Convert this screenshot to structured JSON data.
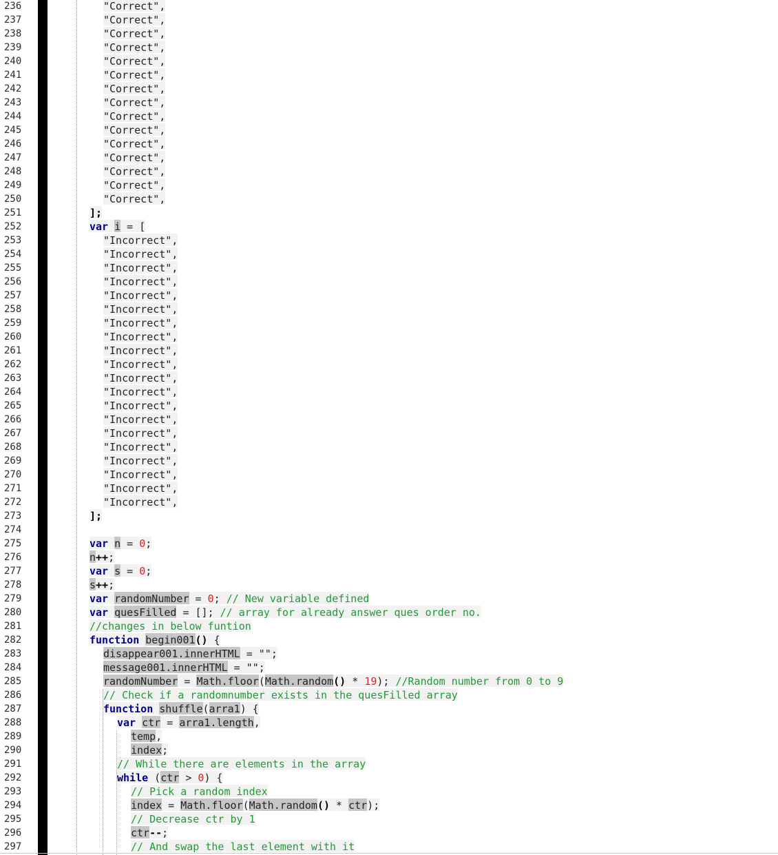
{
  "editor": {
    "lines": [
      {
        "n": "236",
        "i": 150,
        "t": [
          [
            "plain",
            "\"Correct\","
          ]
        ]
      },
      {
        "n": "237",
        "i": 150,
        "t": [
          [
            "plain",
            "\"Correct\","
          ]
        ]
      },
      {
        "n": "238",
        "i": 150,
        "t": [
          [
            "plain",
            "\"Correct\","
          ]
        ]
      },
      {
        "n": "239",
        "i": 150,
        "t": [
          [
            "plain",
            "\"Correct\","
          ]
        ]
      },
      {
        "n": "240",
        "i": 150,
        "t": [
          [
            "plain",
            "\"Correct\","
          ]
        ]
      },
      {
        "n": "241",
        "i": 150,
        "t": [
          [
            "plain",
            "\"Correct\","
          ]
        ]
      },
      {
        "n": "242",
        "i": 150,
        "t": [
          [
            "plain",
            "\"Correct\","
          ]
        ]
      },
      {
        "n": "243",
        "i": 150,
        "t": [
          [
            "plain",
            "\"Correct\","
          ]
        ]
      },
      {
        "n": "244",
        "i": 150,
        "t": [
          [
            "plain",
            "\"Correct\","
          ]
        ]
      },
      {
        "n": "245",
        "i": 150,
        "t": [
          [
            "plain",
            "\"Correct\","
          ]
        ]
      },
      {
        "n": "246",
        "i": 150,
        "t": [
          [
            "plain",
            "\"Correct\","
          ]
        ]
      },
      {
        "n": "247",
        "i": 150,
        "t": [
          [
            "plain",
            "\"Correct\","
          ]
        ]
      },
      {
        "n": "248",
        "i": 150,
        "t": [
          [
            "plain",
            "\"Correct\","
          ]
        ]
      },
      {
        "n": "249",
        "i": 150,
        "t": [
          [
            "plain",
            "\"Correct\","
          ]
        ]
      },
      {
        "n": "250",
        "i": 150,
        "t": [
          [
            "plain",
            "\"Correct\","
          ]
        ]
      },
      {
        "n": "251",
        "i": 130,
        "t": [
          [
            "op",
            "];"
          ]
        ]
      },
      {
        "n": "252",
        "i": 130,
        "t": [
          [
            "kw",
            "var"
          ],
          [
            "plain",
            " "
          ],
          [
            "hl",
            "i"
          ],
          [
            "plain",
            " = ["
          ]
        ]
      },
      {
        "n": "253",
        "i": 150,
        "t": [
          [
            "plain",
            "\"Incorrect\","
          ]
        ]
      },
      {
        "n": "254",
        "i": 150,
        "t": [
          [
            "plain",
            "\"Incorrect\","
          ]
        ]
      },
      {
        "n": "255",
        "i": 150,
        "t": [
          [
            "plain",
            "\"Incorrect\","
          ]
        ]
      },
      {
        "n": "256",
        "i": 150,
        "t": [
          [
            "plain",
            "\"Incorrect\","
          ]
        ]
      },
      {
        "n": "257",
        "i": 150,
        "t": [
          [
            "plain",
            "\"Incorrect\","
          ]
        ]
      },
      {
        "n": "258",
        "i": 150,
        "t": [
          [
            "plain",
            "\"Incorrect\","
          ]
        ]
      },
      {
        "n": "259",
        "i": 150,
        "t": [
          [
            "plain",
            "\"Incorrect\","
          ]
        ]
      },
      {
        "n": "260",
        "i": 150,
        "t": [
          [
            "plain",
            "\"Incorrect\","
          ]
        ]
      },
      {
        "n": "261",
        "i": 150,
        "t": [
          [
            "plain",
            "\"Incorrect\","
          ]
        ]
      },
      {
        "n": "262",
        "i": 150,
        "t": [
          [
            "plain",
            "\"Incorrect\","
          ]
        ]
      },
      {
        "n": "263",
        "i": 150,
        "t": [
          [
            "plain",
            "\"Incorrect\","
          ]
        ]
      },
      {
        "n": "264",
        "i": 150,
        "t": [
          [
            "plain",
            "\"Incorrect\","
          ]
        ]
      },
      {
        "n": "265",
        "i": 150,
        "t": [
          [
            "plain",
            "\"Incorrect\","
          ]
        ]
      },
      {
        "n": "266",
        "i": 150,
        "t": [
          [
            "plain",
            "\"Incorrect\","
          ]
        ]
      },
      {
        "n": "267",
        "i": 150,
        "t": [
          [
            "plain",
            "\"Incorrect\","
          ]
        ]
      },
      {
        "n": "268",
        "i": 150,
        "t": [
          [
            "plain",
            "\"Incorrect\","
          ]
        ]
      },
      {
        "n": "269",
        "i": 150,
        "t": [
          [
            "plain",
            "\"Incorrect\","
          ]
        ]
      },
      {
        "n": "270",
        "i": 150,
        "t": [
          [
            "plain",
            "\"Incorrect\","
          ]
        ]
      },
      {
        "n": "271",
        "i": 150,
        "t": [
          [
            "plain",
            "\"Incorrect\","
          ]
        ]
      },
      {
        "n": "272",
        "i": 150,
        "t": [
          [
            "plain",
            "\"Incorrect\","
          ]
        ]
      },
      {
        "n": "273",
        "i": 130,
        "t": [
          [
            "op",
            "];"
          ]
        ]
      },
      {
        "n": "274",
        "i": 130,
        "t": []
      },
      {
        "n": "275",
        "i": 130,
        "t": [
          [
            "kw",
            "var"
          ],
          [
            "plain",
            " "
          ],
          [
            "hl",
            "n"
          ],
          [
            "plain",
            " = "
          ],
          [
            "num",
            "0"
          ],
          [
            "plain",
            ";"
          ]
        ]
      },
      {
        "n": "276",
        "i": 130,
        "t": [
          [
            "hl",
            "n"
          ],
          [
            "op",
            "++"
          ],
          [
            "plain",
            ";"
          ]
        ]
      },
      {
        "n": "277",
        "i": 130,
        "t": [
          [
            "kw",
            "var"
          ],
          [
            "plain",
            " "
          ],
          [
            "hl",
            "s"
          ],
          [
            "plain",
            " = "
          ],
          [
            "num",
            "0"
          ],
          [
            "plain",
            ";"
          ]
        ]
      },
      {
        "n": "278",
        "i": 130,
        "t": [
          [
            "hl",
            "s"
          ],
          [
            "op",
            "++"
          ],
          [
            "plain",
            ";"
          ]
        ]
      },
      {
        "n": "279",
        "i": 130,
        "t": [
          [
            "kw",
            "var"
          ],
          [
            "plain",
            " "
          ],
          [
            "hl",
            "randomNumber"
          ],
          [
            "plain",
            " = "
          ],
          [
            "num",
            "0"
          ],
          [
            "plain",
            "; "
          ],
          [
            "cm",
            "// New variable defined"
          ]
        ]
      },
      {
        "n": "280",
        "i": 130,
        "t": [
          [
            "kw",
            "var"
          ],
          [
            "plain",
            " "
          ],
          [
            "hl",
            "quesFilled"
          ],
          [
            "plain",
            " = []; "
          ],
          [
            "cm",
            "// array for already answer ques order no."
          ]
        ]
      },
      {
        "n": "281",
        "i": 130,
        "t": [
          [
            "cm",
            "//changes in below funtion"
          ]
        ]
      },
      {
        "n": "282",
        "i": 130,
        "t": [
          [
            "kw",
            "function"
          ],
          [
            "plain",
            " "
          ],
          [
            "hl",
            "begin001"
          ],
          [
            "op",
            "()"
          ],
          [
            "plain",
            " {"
          ]
        ]
      },
      {
        "n": "283",
        "i": 150,
        "t": [
          [
            "hl",
            "disappear001.innerHTML"
          ],
          [
            "plain",
            " = \"\";"
          ]
        ]
      },
      {
        "n": "284",
        "i": 150,
        "t": [
          [
            "hl",
            "message001.innerHTML"
          ],
          [
            "plain",
            " = \"\";"
          ]
        ]
      },
      {
        "n": "285",
        "i": 150,
        "t": [
          [
            "hl",
            "randomNumber"
          ],
          [
            "plain",
            " = "
          ],
          [
            "hl",
            "Math.floor"
          ],
          [
            "plain",
            "("
          ],
          [
            "hl",
            "Math.random"
          ],
          [
            "op",
            "()"
          ],
          [
            "plain",
            " * "
          ],
          [
            "num",
            "19"
          ],
          [
            "plain",
            "); "
          ],
          [
            "cm",
            "//Random number from 0 to 9"
          ]
        ]
      },
      {
        "n": "286",
        "i": 150,
        "t": [
          [
            "cm",
            "// Check if a randomnumber exists in the quesFilled array"
          ]
        ]
      },
      {
        "n": "287",
        "i": 150,
        "t": [
          [
            "kw",
            "function"
          ],
          [
            "plain",
            " "
          ],
          [
            "hl",
            "shuffle"
          ],
          [
            "plain",
            "("
          ],
          [
            "hl",
            "arra1"
          ],
          [
            "plain",
            ") {"
          ]
        ]
      },
      {
        "n": "288",
        "i": 170,
        "t": [
          [
            "kw",
            "var"
          ],
          [
            "plain",
            " "
          ],
          [
            "hl",
            "ctr"
          ],
          [
            "plain",
            " = "
          ],
          [
            "hl",
            "arra1.length"
          ],
          [
            "plain",
            ","
          ]
        ]
      },
      {
        "n": "289",
        "i": 190,
        "t": [
          [
            "hl",
            "temp"
          ],
          [
            "plain",
            ","
          ]
        ]
      },
      {
        "n": "290",
        "i": 190,
        "t": [
          [
            "hl",
            "index"
          ],
          [
            "plain",
            ";"
          ]
        ]
      },
      {
        "n": "291",
        "i": 170,
        "t": [
          [
            "cm",
            "// While there are elements in the array"
          ]
        ]
      },
      {
        "n": "292",
        "i": 170,
        "t": [
          [
            "kw",
            "while"
          ],
          [
            "plain",
            " ("
          ],
          [
            "hl",
            "ctr"
          ],
          [
            "plain",
            " > "
          ],
          [
            "num",
            "0"
          ],
          [
            "plain",
            ") {"
          ]
        ]
      },
      {
        "n": "293",
        "i": 190,
        "t": [
          [
            "cm",
            "// Pick a random index"
          ]
        ]
      },
      {
        "n": "294",
        "i": 190,
        "t": [
          [
            "hl",
            "index"
          ],
          [
            "plain",
            " = "
          ],
          [
            "hl",
            "Math.floor"
          ],
          [
            "plain",
            "("
          ],
          [
            "hl",
            "Math.random"
          ],
          [
            "op",
            "()"
          ],
          [
            "plain",
            " * "
          ],
          [
            "hl",
            "ctr"
          ],
          [
            "plain",
            ");"
          ]
        ]
      },
      {
        "n": "295",
        "i": 190,
        "t": [
          [
            "cm",
            "// Decrease ctr by 1"
          ]
        ]
      },
      {
        "n": "296",
        "i": 190,
        "t": [
          [
            "hl",
            "ctr"
          ],
          [
            "op",
            "--"
          ],
          [
            "plain",
            ";"
          ]
        ]
      },
      {
        "n": "297",
        "i": 190,
        "t": [
          [
            "cm",
            "// And swap the last element with it"
          ]
        ]
      }
    ]
  }
}
